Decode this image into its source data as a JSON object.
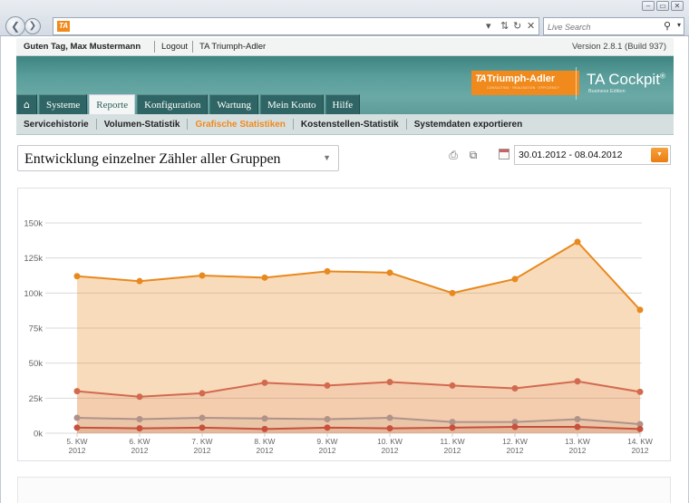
{
  "browser": {
    "window_buttons": [
      "‒",
      "▭",
      "✕"
    ],
    "favicon_text": "TA",
    "search_placeholder": "Live Search"
  },
  "topbar": {
    "greeting": "Guten Tag, Max Mustermann",
    "logout": "Logout",
    "company_link": "TA Triumph-Adler",
    "version": "Version 2.8.1 (Build 937)"
  },
  "brand": {
    "logo_mark": "TA",
    "logo_name": "Triumph-Adler",
    "logo_claim": "CONSULTING · REALISATION · EFFICIENCY",
    "product": "TA Cockpit",
    "product_reg": "®",
    "product_sub": "Business Edition",
    "accent_color": "#f08a1c",
    "header_color": "#4f9290"
  },
  "nav": {
    "home_icon": "⌂",
    "tabs": [
      "Systeme",
      "Reporte",
      "Konfiguration",
      "Wartung",
      "Mein Konto",
      "Hilfe"
    ],
    "active_tab": "Reporte"
  },
  "subnav": {
    "items": [
      "Servicehistorie",
      "Volumen-Statistik",
      "Grafische Statistiken",
      "Kostenstellen-Statistik",
      "Systemdaten exportieren"
    ],
    "active": "Grafische Statistiken"
  },
  "report": {
    "selected": "Entwicklung einzelner Zähler aller Gruppen",
    "date_range": "30.01.2012 - 08.04.2012"
  },
  "chart_data": {
    "type": "area",
    "categories": [
      "5. KW 2012",
      "6. KW 2012",
      "7. KW 2012",
      "8. KW 2012",
      "9. KW 2012",
      "10. KW 2012",
      "11. KW 2012",
      "12. KW 2012",
      "13. KW 2012",
      "14. KW 2012"
    ],
    "x_tick_lines": [
      [
        "5. KW",
        "2012"
      ],
      [
        "6. KW",
        "2012"
      ],
      [
        "7. KW",
        "2012"
      ],
      [
        "8. KW",
        "2012"
      ],
      [
        "9. KW",
        "2012"
      ],
      [
        "10. KW",
        "2012"
      ],
      [
        "11. KW",
        "2012"
      ],
      [
        "12. KW",
        "2012"
      ],
      [
        "13. KW",
        "2012"
      ],
      [
        "14. KW",
        "2012"
      ]
    ],
    "y_ticks": [
      "0k",
      "25k",
      "50k",
      "75k",
      "100k",
      "125k",
      "150k"
    ],
    "ylim": [
      0,
      150000
    ],
    "grid": true,
    "series": [
      {
        "color": "#e8891e",
        "values": [
          112000,
          108500,
          112500,
          111000,
          115500,
          114500,
          100000,
          110000,
          136500,
          88000
        ]
      },
      {
        "color": "#d26a50",
        "values": [
          30000,
          26000,
          28500,
          36000,
          34000,
          36500,
          34000,
          32000,
          37000,
          29500
        ]
      },
      {
        "color": "#b09289",
        "values": [
          11000,
          10000,
          11000,
          10500,
          10000,
          11000,
          8000,
          8000,
          10000,
          6500
        ]
      },
      {
        "color": "#c8503c",
        "values": [
          4000,
          3500,
          4000,
          3000,
          4000,
          3500,
          4000,
          4500,
          4500,
          3000
        ]
      }
    ]
  }
}
